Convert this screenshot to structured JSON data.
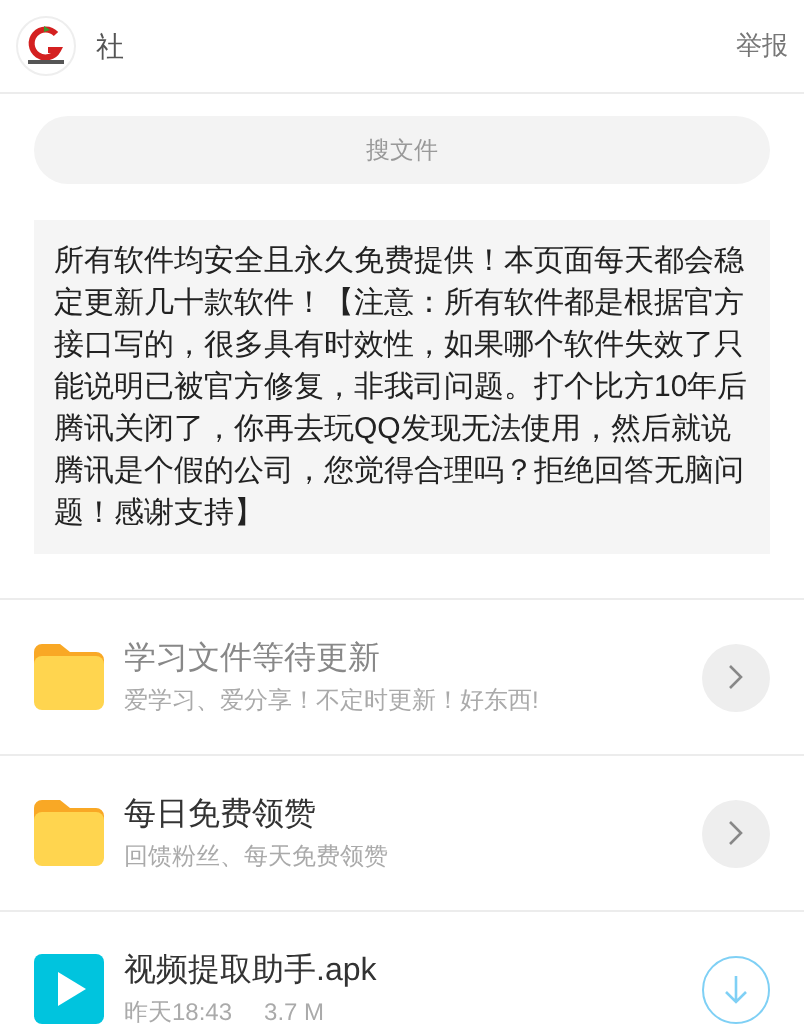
{
  "header": {
    "title": "社",
    "report": "举报"
  },
  "search": {
    "placeholder": "搜文件"
  },
  "notice": "所有软件均安全且永久免费提供！本页面每天都会稳定更新几十款软件！【注意：所有软件都是根据官方接口写的，很多具有时效性，如果哪个软件失效了只能说明已被官方修复，非我司问题。打个比方10年后腾讯关闭了，你再去玩QQ发现无法使用，然后就说腾讯是个假的公司，您觉得合理吗？拒绝回答无脑问题！感谢支持】",
  "items": [
    {
      "kind": "folder",
      "title": "学习文件等待更新",
      "subtitle": "爱学习、爱分享！不定时更新！好东西!",
      "dimmed": true
    },
    {
      "kind": "folder",
      "title": "每日免费领赞",
      "subtitle": "回馈粉丝、每天免费领赞",
      "dimmed": false
    },
    {
      "kind": "file",
      "title": "视频提取助手.apk",
      "date": "昨天18:43",
      "size": "3.7 M",
      "dimmed": false
    }
  ]
}
